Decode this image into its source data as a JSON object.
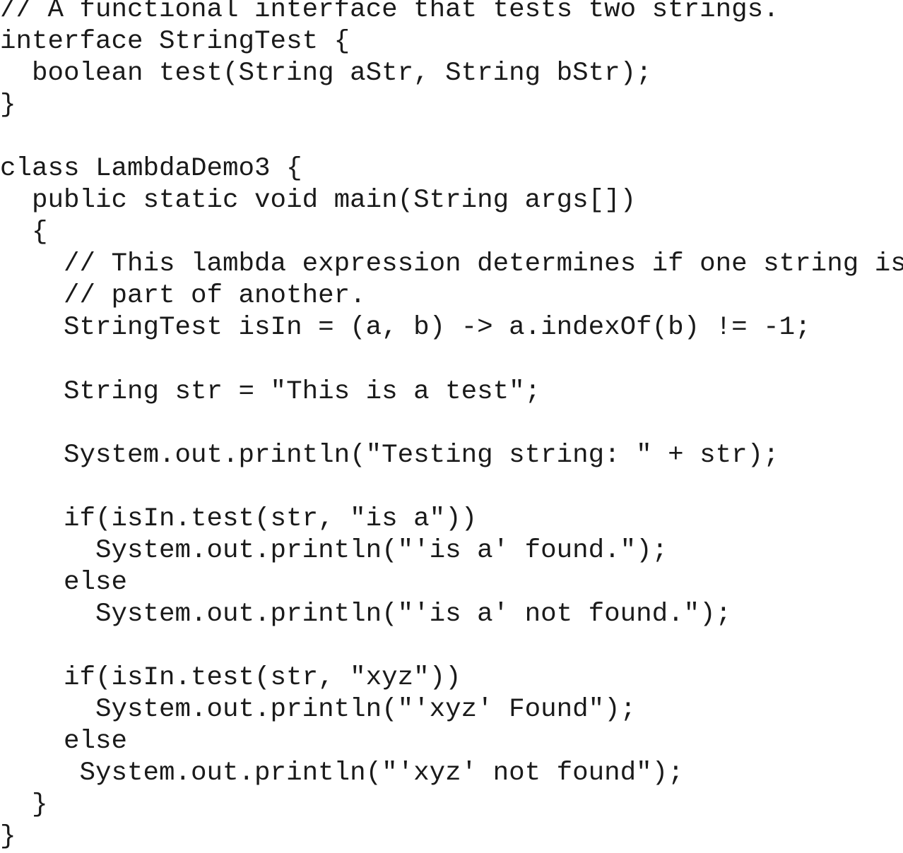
{
  "code": {
    "lines": [
      "// A functional interface that tests two strings.",
      "interface StringTest {",
      "  boolean test(String aStr, String bStr);",
      "}",
      "",
      "class LambdaDemo3 {",
      "  public static void main(String args[])",
      "  {",
      "    // This lambda expression determines if one string is",
      "    // part of another.",
      "    StringTest isIn = (a, b) -> a.indexOf(b) != -1;",
      "",
      "    String str = \"This is a test\";",
      "",
      "    System.out.println(\"Testing string: \" + str);",
      "",
      "    if(isIn.test(str, \"is a\"))",
      "      System.out.println(\"'is a' found.\");",
      "    else",
      "      System.out.println(\"'is a' not found.\");",
      "",
      "    if(isIn.test(str, \"xyz\"))",
      "      System.out.println(\"'xyz' Found\");",
      "    else",
      "     System.out.println(\"'xyz' not found\");",
      "  }",
      "}"
    ]
  }
}
